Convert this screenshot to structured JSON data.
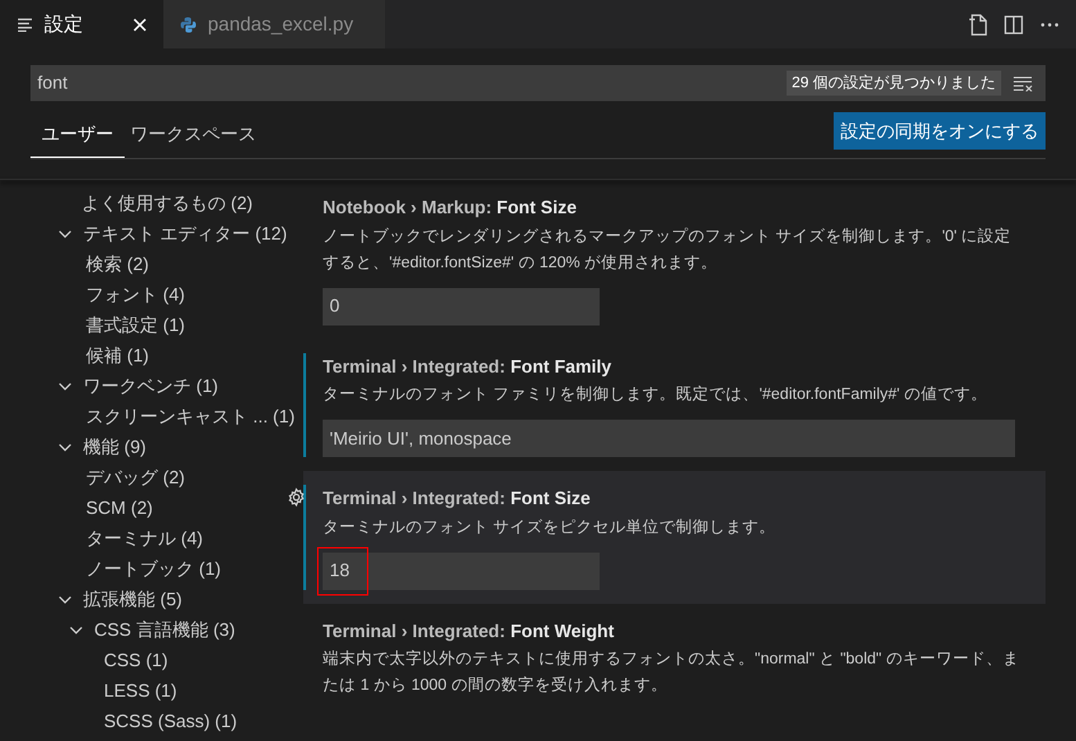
{
  "tabs": [
    {
      "label": "設定",
      "kind": "settings",
      "selected": true,
      "closable": true
    },
    {
      "label": "pandas_excel.py",
      "kind": "python",
      "selected": false,
      "closable": false
    }
  ],
  "search": {
    "value": "font",
    "result_count": "29 個の設定が見つかりました"
  },
  "scope_tabs": [
    {
      "label": "ユーザー",
      "selected": true
    },
    {
      "label": "ワークスペース",
      "selected": false
    }
  ],
  "sync_button": "設定の同期をオンにする",
  "tree": [
    {
      "label": "よく使用するもの",
      "count": "(2)"
    },
    {
      "label": "テキスト エディター",
      "count": "(12)",
      "expanded": true,
      "children": [
        {
          "label": "検索",
          "count": "(2)"
        },
        {
          "label": "フォント",
          "count": "(4)"
        },
        {
          "label": "書式設定",
          "count": "(1)"
        },
        {
          "label": "候補",
          "count": "(1)"
        }
      ]
    },
    {
      "label": "ワークベンチ",
      "count": "(1)",
      "expanded": true,
      "children": [
        {
          "label": "スクリーンキャスト ...",
          "count": "(1)"
        }
      ]
    },
    {
      "label": "機能",
      "count": "(9)",
      "expanded": true,
      "children": [
        {
          "label": "デバッグ",
          "count": "(2)"
        },
        {
          "label": "SCM",
          "count": "(2)"
        },
        {
          "label": "ターミナル",
          "count": "(4)"
        },
        {
          "label": "ノートブック",
          "count": "(1)"
        }
      ]
    },
    {
      "label": "拡張機能",
      "count": "(5)",
      "expanded": true,
      "children": [
        {
          "label": "CSS 言語機能",
          "count": "(3)",
          "expanded": true,
          "children": [
            {
              "label": "CSS",
              "count": "(1)"
            },
            {
              "label": "LESS",
              "count": "(1)"
            },
            {
              "label": "SCSS (Sass)",
              "count": "(1)"
            }
          ]
        }
      ]
    }
  ],
  "settings": [
    {
      "category": "Notebook › Markup: ",
      "name": "Font Size",
      "description": "ノートブックでレンダリングされるマークアップのフォント サイズを制御します。'0' に設定すると、'#editor.fontSize#' の 120% が使用されます。",
      "value": "0",
      "wide": false,
      "modified": false,
      "focused": false,
      "marked": false
    },
    {
      "category": "Terminal › Integrated: ",
      "name": "Font Family",
      "description": "ターミナルのフォント ファミリを制御します。既定では、'#editor.fontFamily#' の値です。",
      "value": "'Meirio UI', monospace",
      "modified": true,
      "focused": false,
      "marked": false,
      "wide": true
    },
    {
      "category": "Terminal › Integrated: ",
      "name": "Font Size",
      "description": "ターミナルのフォント サイズをピクセル単位で制御します。",
      "value": "18",
      "wide": false,
      "modified": true,
      "focused": true,
      "marked": true
    },
    {
      "category": "Terminal › Integrated: ",
      "name": "Font Weight",
      "description": "端末内で太字以外のテキストに使用するフォントの太さ。\"normal\" と \"bold\" のキーワード、または 1 から 1000 の間の数字を受け入れます。",
      "modified": false,
      "focused": false,
      "marked": false
    }
  ]
}
